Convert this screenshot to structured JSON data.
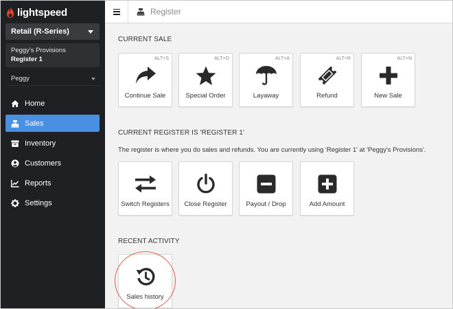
{
  "brand": {
    "name": "lightspeed",
    "logo_color": "#e5422e"
  },
  "sidebar": {
    "store_select": "Retail (R-Series)",
    "shop_name": "Peggy's Provisions",
    "register_name": "Register 1",
    "user": "Peggy",
    "items": [
      {
        "label": "Home",
        "icon": "home-icon",
        "active": false
      },
      {
        "label": "Sales",
        "icon": "register-icon",
        "active": true
      },
      {
        "label": "Inventory",
        "icon": "inventory-icon",
        "active": false
      },
      {
        "label": "Customers",
        "icon": "customer-icon",
        "active": false
      },
      {
        "label": "Reports",
        "icon": "chart-icon",
        "active": false
      },
      {
        "label": "Settings",
        "icon": "gear-icon",
        "active": false
      }
    ],
    "active_color": "#4a90e2"
  },
  "topbar": {
    "title": "Register"
  },
  "current_sale": {
    "title": "CURRENT SALE",
    "tiles": [
      {
        "label": "Continue Sale",
        "hotkey": "ALT+S",
        "icon": "forward-arrow-icon"
      },
      {
        "label": "Special Order",
        "hotkey": "ALT+O",
        "icon": "star-icon"
      },
      {
        "label": "Layaway",
        "hotkey": "ALT+A",
        "icon": "umbrella-icon"
      },
      {
        "label": "Refund",
        "hotkey": "ALT+R",
        "icon": "ticket-icon"
      },
      {
        "label": "New Sale",
        "hotkey": "ALT+N",
        "icon": "plus-icon"
      }
    ]
  },
  "current_register": {
    "title": "CURRENT REGISTER IS 'REGISTER 1'",
    "description": "The register is where you do sales and refunds. You are currently using 'Register 1'  at 'Peggy's Provisions'.",
    "tiles": [
      {
        "label": "Switch Registers",
        "icon": "swap-arrows-icon"
      },
      {
        "label": "Close Register",
        "icon": "power-icon"
      },
      {
        "label": "Payout / Drop",
        "icon": "minus-square-icon"
      },
      {
        "label": "Add Amount",
        "icon": "plus-square-icon"
      }
    ]
  },
  "recent_activity": {
    "title": "RECENT ACTIVITY",
    "tiles": [
      {
        "label": "Sales history",
        "icon": "history-icon"
      }
    ]
  }
}
